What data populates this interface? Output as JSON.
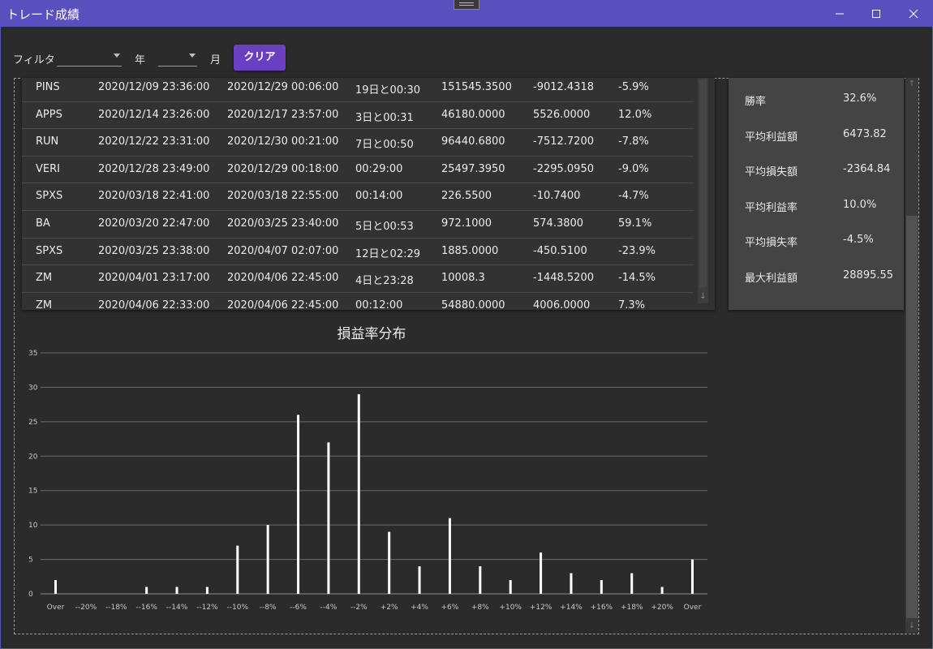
{
  "window": {
    "title": "トレード成績",
    "minimize_icon": "minimize-icon",
    "maximize_icon": "maximize-icon",
    "close_icon": "close-icon"
  },
  "filter": {
    "label": "フィルタ",
    "filter_value": "",
    "year_label": "年",
    "year_value": "",
    "month_label": "月",
    "clear_label": "クリア",
    "clear_color": "#6a3fc1"
  },
  "trades": [
    {
      "symbol": "PINS",
      "open": "2020/12/09 23:36:00",
      "close": "2020/12/29 00:06:00",
      "duration": "19日と00:30",
      "amount": "151545.3500",
      "pnl": "-9012.4318",
      "rate": "-5.9%"
    },
    {
      "symbol": "APPS",
      "open": "2020/12/14 23:26:00",
      "close": "2020/12/17 23:57:00",
      "duration": "3日と00:31",
      "amount": "46180.0000",
      "pnl": "5526.0000",
      "rate": "12.0%"
    },
    {
      "symbol": "RUN",
      "open": "2020/12/22 23:31:00",
      "close": "2020/12/30 00:21:00",
      "duration": "7日と00:50",
      "amount": "96440.6800",
      "pnl": "-7512.7200",
      "rate": "-7.8%"
    },
    {
      "symbol": "VERI",
      "open": "2020/12/28 23:49:00",
      "close": "2020/12/29 00:18:00",
      "duration": "00:29:00",
      "amount": "25497.3950",
      "pnl": "-2295.0950",
      "rate": "-9.0%"
    },
    {
      "symbol": "SPXS",
      "open": "2020/03/18 22:41:00",
      "close": "2020/03/18 22:55:00",
      "duration": "00:14:00",
      "amount": "226.5500",
      "pnl": "-10.7400",
      "rate": "-4.7%"
    },
    {
      "symbol": "BA",
      "open": "2020/03/20 22:47:00",
      "close": "2020/03/25 23:40:00",
      "duration": "5日と00:53",
      "amount": "972.1000",
      "pnl": "574.3800",
      "rate": "59.1%"
    },
    {
      "symbol": "SPXS",
      "open": "2020/03/25 23:38:00",
      "close": "2020/04/07 02:07:00",
      "duration": "12日と02:29",
      "amount": "1885.0000",
      "pnl": "-450.5100",
      "rate": "-23.9%"
    },
    {
      "symbol": "ZM",
      "open": "2020/04/01 23:17:00",
      "close": "2020/04/06 22:45:00",
      "duration": "4日と23:28",
      "amount": "10008.3",
      "pnl": "-1448.5200",
      "rate": "-14.5%"
    },
    {
      "symbol": "ZM",
      "open": "2020/04/06 22:33:00",
      "close": "2020/04/06 22:45:00",
      "duration": "00:12:00",
      "amount": "54880.0000",
      "pnl": "4006.0000",
      "rate": "7.3%"
    }
  ],
  "stats": [
    {
      "label": "勝率",
      "value": "32.6%"
    },
    {
      "label": "平均利益額",
      "value": "6473.82"
    },
    {
      "label": "平均損失額",
      "value": "-2364.84"
    },
    {
      "label": "平均利益率",
      "value": "10.0%"
    },
    {
      "label": "平均損失率",
      "value": "-4.5%"
    },
    {
      "label": "最大利益額",
      "value": "28895.55"
    }
  ],
  "chart_data": {
    "type": "bar",
    "title": "損益率分布",
    "xlabel": "",
    "ylabel": "",
    "ylim": [
      0,
      35
    ],
    "yticks": [
      0,
      5,
      10,
      15,
      20,
      25,
      30,
      35
    ],
    "grid": true,
    "bar_color": "#ffffff",
    "categories": [
      "Over",
      "--20%",
      "--18%",
      "--16%",
      "--14%",
      "--12%",
      "--10%",
      "--8%",
      "--6%",
      "--4%",
      "--2%",
      "+2%",
      "+4%",
      "+6%",
      "+8%",
      "+10%",
      "+12%",
      "+14%",
      "+16%",
      "+18%",
      "+20%",
      "Over"
    ],
    "values": [
      2,
      0,
      0,
      1,
      1,
      1,
      7,
      10,
      26,
      22,
      29,
      9,
      4,
      11,
      4,
      2,
      6,
      3,
      2,
      3,
      1,
      5
    ]
  }
}
